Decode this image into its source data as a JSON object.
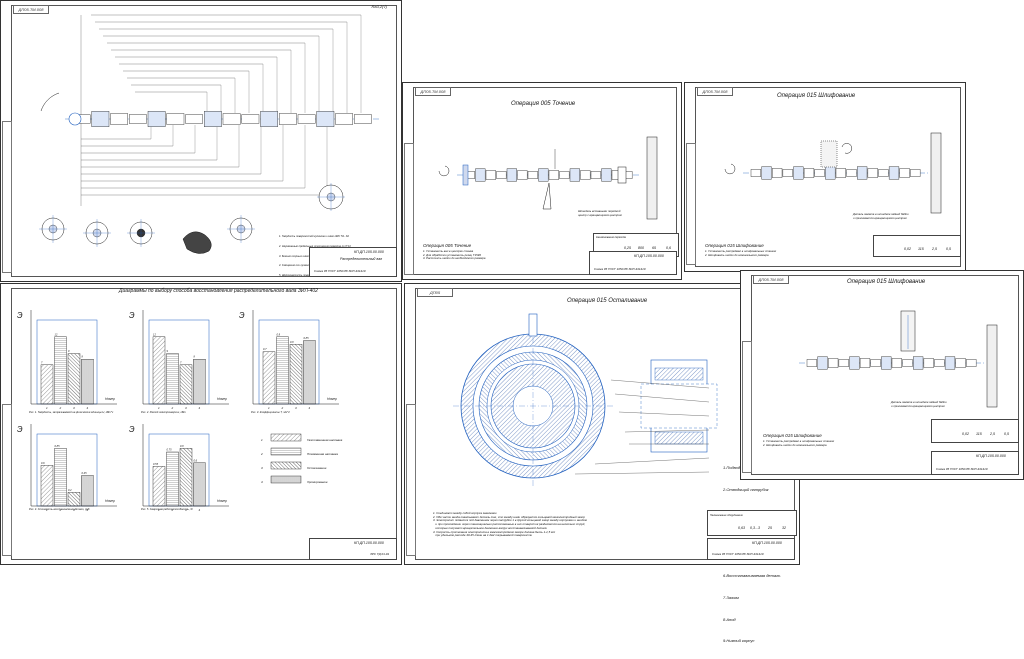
{
  "sheets": {
    "camshaft": {
      "stamp": "ДП05.ТМ.008",
      "stamp_right": "Ra3,2(√)",
      "notes": [
        "1. Твердость поверхностей кулачков и шеек НRC 54...62",
        "2. Неуказанные предельные отклонения размеров по IT14",
        "3. Биение опорных шеек не более 0,02 мм",
        "4. Смещение оси кулачков не более 0,05 мм",
        "5. Шероховатость поверхностей по Ra 0,63...1,25",
        "6. Маркировать обозначение детали"
      ],
      "title_code": "КП.ДП.105.00.000",
      "title_name": "Распределительный вал",
      "title_doc": "Схема 05 ГОСТ 1050-88 ЗИЛ-431410"
    },
    "turning": {
      "stamp": "ДП05.ТМ.008",
      "op_title": "Операция 005 Точение",
      "op_sub": "Операция 005 Точение",
      "steps": "1. Установить вал в центрах станка\n2. Для обработки установить резец Т15К6\n3. Расточить шейки до необходимого размера",
      "note_right": "Шпиндель вставными передний\nцентр с вращающимся центром",
      "tb_headers": [
        "Наименование перехода",
        "S",
        "n",
        "V",
        "To"
      ],
      "tb_values": [
        "0,25",
        "800",
        "65",
        "0,6"
      ],
      "title_code": "КП.ДП.105.00.000",
      "title_doc": "Схема 05 ГОСТ 1050-88 ЗИЛ-431410"
    },
    "grinding1": {
      "stamp": "ДП05.ТМ.008",
      "op_title": "Операция 015 Шлифование",
      "op_sub": "Операция 015 Шлифование",
      "steps": "1. Установить распредвал в шлифовальных станках\n2. Шлифовать шейки до номинального размера",
      "note_right": "Деталь зажата в шпинделе задней бабки\nи прижимается вращающимся центром",
      "tb_values": [
        "0,02",
        "115",
        "2,5",
        "0,5"
      ],
      "title_code": "КП.ДП.105.00.000",
      "title_doc": "Схема 05 ГОСТ 1050-88 ЗИЛ-431410"
    },
    "diagrams": {
      "title": "Диаграммы по выбору способа восстановления распределительного вала ЗИЛ-402",
      "legend": [
        {
          "num": "1",
          "label": "Газопламенная наплавка"
        },
        {
          "num": "2",
          "label": "Плазменная наплавка"
        },
        {
          "num": "3",
          "label": "Осталивание"
        },
        {
          "num": "4",
          "label": "Хромирование"
        }
      ],
      "captions": [
        "Рис. 1. Твердость, затрачиваемой на физические единицы Н, кВт*ч",
        "Рис. 2. Расход электроэнергии, кВт",
        "Рис. 3. Коэффициенты Т, ч/м^2",
        "Рис. 4. Стоимость восстановления детали, руб",
        "Рис. 5. Сварочная работоспособность, %"
      ],
      "title_code": "КП.ДП.105.00.000",
      "title_doc": "ЗРС ТД 01-91"
    },
    "ironing": {
      "stamp": "ДП05",
      "op_title": "Операция 015 Осталивание",
      "parts": [
        "1.Подводящий патрубок",
        "2.Отводящий патрубок",
        "3.Кабель",
        "4.Верхний корпус",
        "5.Уплотняющая прокладка",
        "6.Восстанавливаемая деталь",
        "7.Зажим",
        "8.Анод",
        "9.Нижний корпус"
      ],
      "steps": "1. Соединяют между собой корпуса зажимами\n2. Обе части анода охватывают деталь так, что между ними образуется кольцевой межэлектродный зазор\n3. Электролит подается под давлением через патрубок 1 в другой кольцевой зазор между корпусами и анодом\n   и при прохождении через тангенциально расположенные в них отверстия разделяется на несколько струй,\n   которые получают вращательное движение вокруг восстанавливаемой детали\n4. Скорость протекания электролита в межэлектродном зазоре должна быть 1-1,5 м/с\n   при удельном расходе 40-45 л/мин на 1 дм2 покрываемой поверхности",
      "tb_headers": [
        "Наименование оборудования",
        "Ra",
        "Е, кг/м2",
        "Дк, А/дм2",
        "To"
      ],
      "tb_values": [
        "0,63",
        "0,3...3",
        "25",
        "32"
      ],
      "title_code": "КП.ДП.105.00.000",
      "title_doc": "Схема 05 ГОСТ 1050-88 ЗИЛ-431410"
    },
    "grinding2": {
      "stamp": "ДП05.ТМ.008",
      "op_title": "Операция 015 Шлифование",
      "op_sub": "Операция 015 Шлифование",
      "steps": "1. Установить распредвал в шлифовальных станках\n2. Шлифовать шейки до номинального размера",
      "note_right": "Деталь зажата в шпинделе задней бабки\nи прижимается вращающимся центром",
      "tb_values": [
        "0,02",
        "115",
        "2,5",
        "0,5"
      ],
      "title_code": "КП.ДП.105.00.000",
      "title_doc": "Схема 05 ГОСТ 1050-88 ЗИЛ-431410"
    }
  },
  "chart_data": [
    {
      "type": "bar",
      "categories": [
        "1",
        "2",
        "3",
        "4"
      ],
      "values": [
        7,
        12,
        9,
        8
      ],
      "ylabel": "Э",
      "xlabel": "Номер"
    },
    {
      "type": "bar",
      "categories": [
        "1",
        "2",
        "3",
        "4"
      ],
      "values": [
        12,
        9,
        7,
        8
      ],
      "ylabel": "Э",
      "xlabel": "Номер"
    },
    {
      "type": "bar",
      "categories": [
        "1",
        "2",
        "3",
        "4"
      ],
      "values": [
        0.7,
        0.9,
        0.8,
        0.85
      ],
      "ylabel": "Э",
      "xlabel": "Номер"
    },
    {
      "type": "bar",
      "categories": [
        "1",
        "2",
        "3",
        "4"
      ],
      "values": [
        0.6,
        0.85,
        0.2,
        0.45
      ],
      "ylabel": "Э",
      "xlabel": "Номер"
    },
    {
      "type": "bar",
      "categories": [
        "1",
        "2",
        "3",
        "4"
      ],
      "values": [
        0.55,
        0.75,
        0.8,
        0.6
      ],
      "ylabel": "Э",
      "xlabel": "Номер"
    }
  ],
  "colors": {
    "line": "#1a1a1a",
    "axis": "#1f5fbf",
    "accent": "#2f6fd0",
    "hatch": "#555555"
  }
}
